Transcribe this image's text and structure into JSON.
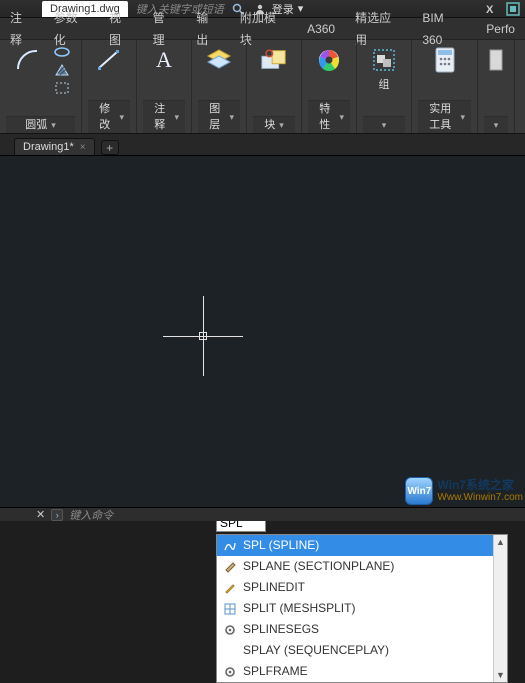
{
  "titlebar": {
    "filename": "Drawing1.dwg",
    "search_hint": "键入关键字或短语",
    "login_label": "登录",
    "login_icon": "user-icon",
    "dropdown": "▾"
  },
  "ribbon_tabs": [
    "注释",
    "参数化",
    "视图",
    "管理",
    "输出",
    "附加模块",
    "A360",
    "精选应用",
    "BIM 360",
    "Perfo"
  ],
  "ribbon_panels": {
    "drawarc": {
      "label": "圆弧"
    },
    "modify": {
      "label": "修改"
    },
    "annotate": {
      "label": "注释"
    },
    "layers": {
      "label": "图层"
    },
    "block": {
      "label": "块"
    },
    "props": {
      "label": "特性"
    },
    "group": {
      "label": "组"
    },
    "util": {
      "label": "实用工具"
    }
  },
  "doc_tab": {
    "name": "Drawing1*",
    "close": "×",
    "new": "+"
  },
  "dynamic_input": "SPL",
  "autocomplete": [
    {
      "icon": "spline-icon",
      "label": "SPL (SPLINE)"
    },
    {
      "icon": "plane-icon",
      "label": "SPLANE (SECTIONPLANE)"
    },
    {
      "icon": "pencil-icon",
      "label": "SPLINEDIT"
    },
    {
      "icon": "mesh-icon",
      "label": "SPLIT (MESHSPLIT)"
    },
    {
      "icon": "gear-icon",
      "label": "SPLINESEGS"
    },
    {
      "icon": "blank-icon",
      "label": "SPLAY (SEQUENCEPLAY)"
    },
    {
      "icon": "gear-icon",
      "label": "SPLFRAME"
    }
  ],
  "watermark": {
    "logo": "Win7",
    "line1": "Win7系统之家",
    "line2": "Www.Winwin7.com"
  },
  "cmdbar": {
    "prompt": "键入命令",
    "chevron": "›"
  }
}
